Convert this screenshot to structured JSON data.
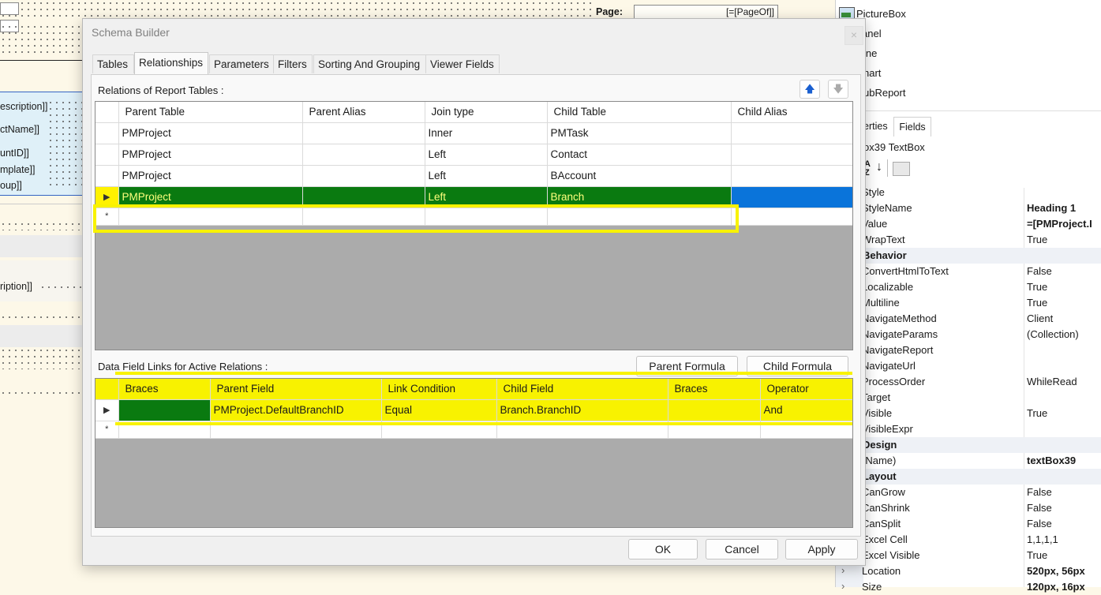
{
  "designer": {
    "page_label": "Page:",
    "page_field": "[=[PageOf]]",
    "bg_fields": [
      "escription]]",
      "ctName]]",
      "untID]]",
      "mplate]]",
      "oup]]",
      "ription]]"
    ]
  },
  "toolbox": {
    "items": [
      "PictureBox",
      "anel",
      "ine",
      "hart",
      "ubReport"
    ]
  },
  "properties": {
    "tabs": [
      "erties",
      "Fields"
    ],
    "object_name": "ox39 TextBox",
    "sort_icon_label": "A↓Z",
    "rows": [
      {
        "name": "Style",
        "value": "",
        "type": "prop"
      },
      {
        "name": "StyleName",
        "value": "Heading 1",
        "type": "prop",
        "bold": true
      },
      {
        "name": "Value",
        "value": "=[PMProject.I",
        "type": "prop",
        "bold": true
      },
      {
        "name": "WrapText",
        "value": "True",
        "type": "prop"
      },
      {
        "name": "Behavior",
        "value": "",
        "type": "cat"
      },
      {
        "name": "ConvertHtmlToText",
        "value": "False",
        "type": "prop"
      },
      {
        "name": "Localizable",
        "value": "True",
        "type": "prop"
      },
      {
        "name": "Multiline",
        "value": "True",
        "type": "prop"
      },
      {
        "name": "NavigateMethod",
        "value": "Client",
        "type": "prop"
      },
      {
        "name": "NavigateParams",
        "value": "(Collection)",
        "type": "prop"
      },
      {
        "name": "NavigateReport",
        "value": "",
        "type": "prop"
      },
      {
        "name": "NavigateUrl",
        "value": "",
        "type": "prop"
      },
      {
        "name": "ProcessOrder",
        "value": "WhileRead",
        "type": "prop"
      },
      {
        "name": "Target",
        "value": "",
        "type": "prop"
      },
      {
        "name": "Visible",
        "value": "True",
        "type": "prop"
      },
      {
        "name": "VisibleExpr",
        "value": "",
        "type": "prop"
      },
      {
        "name": "Design",
        "value": "",
        "type": "cat"
      },
      {
        "name": "(Name)",
        "value": "textBox39",
        "type": "prop",
        "bold": true
      },
      {
        "name": "Layout",
        "value": "",
        "type": "cat"
      },
      {
        "name": "CanGrow",
        "value": "False",
        "type": "prop"
      },
      {
        "name": "CanShrink",
        "value": "False",
        "type": "prop"
      },
      {
        "name": "CanSplit",
        "value": "False",
        "type": "prop"
      },
      {
        "name": "Excel Cell",
        "value": "1,1,1,1",
        "type": "prop"
      },
      {
        "name": "Excel Visible",
        "value": "True",
        "type": "prop"
      },
      {
        "name": "Location",
        "value": "520px, 56px",
        "type": "prop",
        "bold": true
      },
      {
        "name": "Size",
        "value": "120px, 16px",
        "type": "prop",
        "bold": true
      }
    ]
  },
  "dialog": {
    "title": "Schema Builder",
    "close_label": "×",
    "tabs": [
      "Tables",
      "Relationships",
      "Parameters",
      "Filters",
      "Sorting And Grouping",
      "Viewer Fields"
    ],
    "active_tab": "Relationships",
    "relations_label": "Relations of Report Tables :",
    "up_icon": "🡅",
    "down_icon": "🡇",
    "relations": {
      "columns": [
        "Parent Table",
        "Parent Alias",
        "Join type",
        "Child Table",
        "Child Alias"
      ],
      "rows": [
        {
          "parent_table": "PMProject",
          "parent_alias": "",
          "join_type": "Inner",
          "child_table": "PMTask",
          "child_alias": ""
        },
        {
          "parent_table": "PMProject",
          "parent_alias": "",
          "join_type": "Left",
          "child_table": "Contact",
          "child_alias": ""
        },
        {
          "parent_table": "PMProject",
          "parent_alias": "",
          "join_type": "Left",
          "child_table": "BAccount",
          "child_alias": ""
        },
        {
          "parent_table": "PMProject",
          "parent_alias": "",
          "join_type": "Left",
          "child_table": "Branch",
          "child_alias": ""
        }
      ],
      "selected_row": 3,
      "new_row_marker": "*",
      "current_row_marker": "▶"
    },
    "links_label": "Data Field Links for Active Relations :",
    "parent_formula_label": "Parent Formula",
    "child_formula_label": "Child Formula",
    "links": {
      "columns": [
        "Braces",
        "Parent Field",
        "Link Condition",
        "Child Field",
        "Braces",
        "Operator"
      ],
      "rows": [
        {
          "open_braces": "",
          "parent_field": "PMProject.DefaultBranchID",
          "link_condition": "Equal",
          "child_field": "Branch.BranchID",
          "close_braces": "",
          "operator": "And"
        }
      ]
    },
    "ok_label": "OK",
    "cancel_label": "Cancel",
    "apply_label": "Apply"
  }
}
